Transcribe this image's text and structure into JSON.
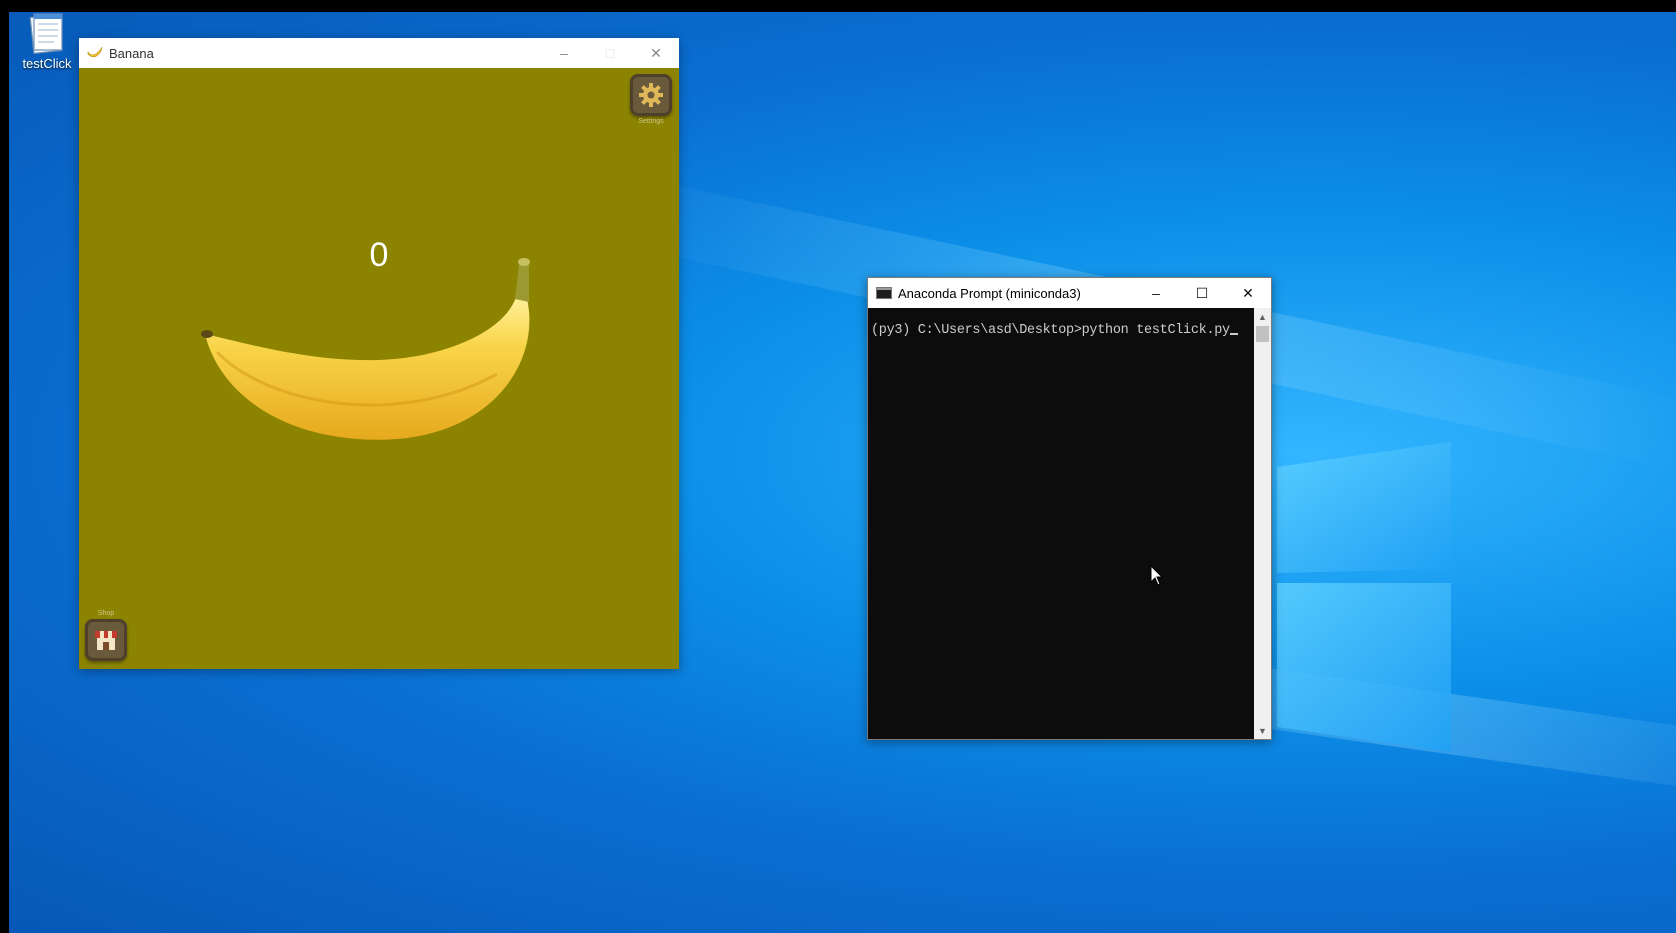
{
  "desktop": {
    "icons": [
      {
        "label": "testClick",
        "icon": "notepad-file-icon"
      }
    ]
  },
  "banana_window": {
    "title": "Banana",
    "icon": "banana-icon",
    "controls": {
      "minimize": "–",
      "maximize": "□",
      "close": "✕"
    },
    "counter": "0",
    "settings_label": "Settings",
    "shop_label": "Shop"
  },
  "console_window": {
    "title": "Anaconda Prompt (miniconda3)",
    "icon": "terminal-icon",
    "controls": {
      "minimize": "–",
      "maximize": "☐",
      "close": "✕"
    },
    "prompt_line": "(py3) C:\\Users\\asd\\Desktop>python testClick.py"
  },
  "colors": {
    "banana_background": "#8c8400",
    "console_background": "#0c0c0c",
    "console_text": "#cccccc",
    "desktop_accent": "#0a8ce6"
  }
}
